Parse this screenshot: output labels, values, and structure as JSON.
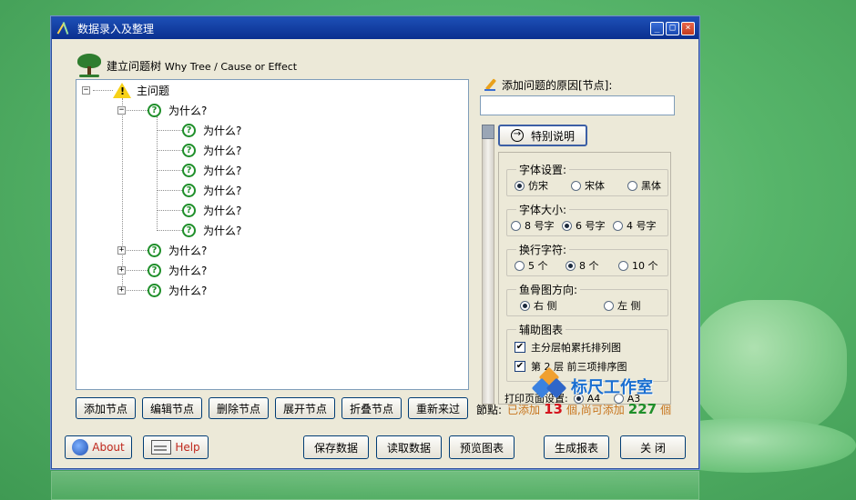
{
  "window": {
    "title": "数据录入及整理",
    "minimize": "_",
    "maximize": "□",
    "close": "×"
  },
  "tree": {
    "header_cn": "建立问题树",
    "header_en": "Why Tree / Cause or Effect",
    "root": {
      "label": "主问题",
      "expander": "−"
    },
    "level1_expanded": {
      "label": "为什么?",
      "expander": "−"
    },
    "level2": [
      "为什么?",
      "为什么?",
      "为什么?",
      "为什么?",
      "为什么?",
      "为什么?"
    ],
    "level1_collapsed": [
      "为什么?",
      "为什么?",
      "为什么?"
    ],
    "collapsed_expander": "+",
    "question_glyph": "?",
    "warn_glyph": "!"
  },
  "cause": {
    "label": "添加问题的原因[节点]:",
    "value": ""
  },
  "note_button": {
    "label": "特别说明",
    "glyph": "→"
  },
  "settings": {
    "font": {
      "title": "字体设置:",
      "options": [
        "仿宋",
        "宋体",
        "黑体"
      ],
      "selected": 0
    },
    "size": {
      "title": "字体大小:",
      "options": [
        "8 号字",
        "6 号字",
        "4 号字"
      ],
      "selected": 1
    },
    "wrap": {
      "title": "换行字符:",
      "options": [
        "5 个",
        "8 个",
        "10 个"
      ],
      "selected": 1
    },
    "direction": {
      "title": "鱼骨图方向:",
      "options": [
        "右 侧",
        "左 侧"
      ],
      "selected": 0
    },
    "aux": {
      "title": "辅助图表",
      "items": [
        "主分层帕累托排列图",
        "第 2 层 前三项排序图"
      ],
      "check_glyph": "✔"
    },
    "print": {
      "title": "打印页面设置:",
      "options": [
        "A4",
        "A3"
      ],
      "selected": 0
    }
  },
  "node_buttons": [
    "添加节点",
    "编辑节点",
    "删除节点",
    "展开节点",
    "折叠节点",
    "重新来过"
  ],
  "counts": {
    "label": "節點:",
    "added_prefix": "已添加",
    "added": "13",
    "mid": "個,尚可添加",
    "remaining": "227",
    "suffix": "個"
  },
  "brand": {
    "text": "标尺工作室"
  },
  "bottom": {
    "about": "About",
    "help": "Help",
    "save": "保存数据",
    "read": "读取数据",
    "preview": "预览图表",
    "report": "生成报表",
    "close": "关 闭"
  },
  "colors": {
    "accent_green": "#1f8f2a",
    "count_red": "#d4141d",
    "count_green": "#1f8f2a",
    "label_orange": "#c7741c",
    "title_blue": "#0a2f8f"
  }
}
